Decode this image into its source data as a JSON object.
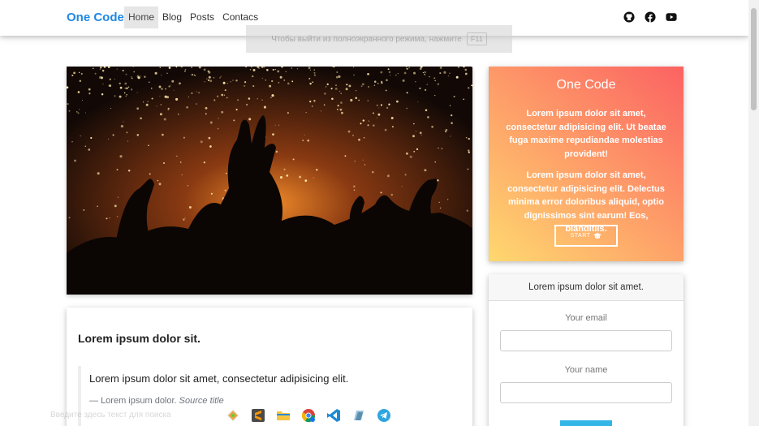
{
  "navbar": {
    "brand": "One Code",
    "links": [
      {
        "label": "Home",
        "active": true
      },
      {
        "label": "Blog"
      },
      {
        "label": "Posts"
      },
      {
        "label": "Contacs"
      }
    ],
    "icons": [
      "github-icon",
      "facebook-icon",
      "youtube-icon"
    ]
  },
  "fullscreen_notice": {
    "text": "Чтобы выйти из полноэкранного режима, нажмите",
    "key": "F11"
  },
  "hero": {
    "icon": "concert-crowd-image"
  },
  "post": {
    "title": "Lorem ipsum dolor sit.",
    "quote": "Lorem ipsum dolor sit amet, consectetur adipisicing elit.",
    "footer_text": "Lorem ipsum dolor.",
    "footer_source": "Source title"
  },
  "promo": {
    "title": "One Code",
    "paragraph1": "Lorem ipsum dolor sit amet, consectetur adipisicing elit. Ut beatae fuga maxime repudiandae molestias provident!",
    "paragraph2": "Lorem ipsum dolor sit amet, consectetur adipisicing elit. Delectus minima error doloribus aliquid, optio dignissimos sint earum! Eos, blanditiis.",
    "button_label": "START",
    "colors": {
      "gradient_start": "#ffd86f",
      "gradient_end": "#fc6262"
    }
  },
  "form": {
    "header": "Lorem ipsum dolor sit amet.",
    "email_label": "Your email",
    "name_label": "Your name",
    "button_color": "#33b5e5"
  },
  "taskbar": {
    "hint": "Введите здесь текст для поиска",
    "icons": [
      "git-icon",
      "sublime-text-icon",
      "file-explorer-icon",
      "chrome-icon",
      "vscode-icon",
      "app-icon",
      "telegram-icon"
    ]
  },
  "colors": {
    "brand": "#1e88e5",
    "nav_active_bg": "#e6e6e6"
  }
}
